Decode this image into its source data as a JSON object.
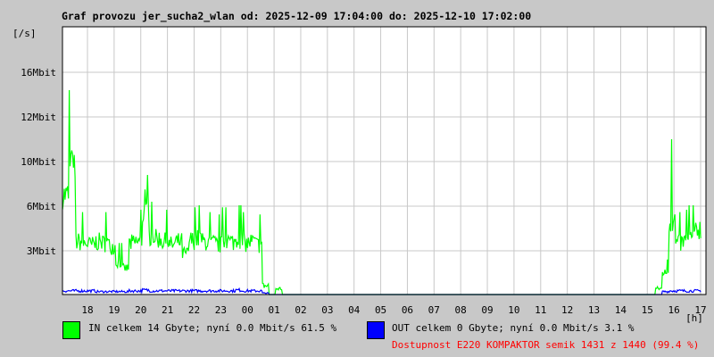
{
  "chart_data": {
    "type": "line",
    "title": "Graf provozu jer_sucha2_wlan od: 2025-12-09 17:04:00 do: 2025-12-10 17:02:00",
    "ylabel": "[/s]",
    "xlabel": "[h]",
    "y_ticks": [
      {
        "label": "3Mbit",
        "value": 3
      },
      {
        "label": "6Mbit",
        "value": 6
      },
      {
        "label": "10Mbit",
        "value": 10
      },
      {
        "label": "12Mbit",
        "value": 12
      },
      {
        "label": "16Mbit",
        "value": 16
      }
    ],
    "x_ticks": [
      "18",
      "19",
      "20",
      "21",
      "22",
      "23",
      "00",
      "01",
      "02",
      "03",
      "04",
      "05",
      "06",
      "07",
      "08",
      "09",
      "10",
      "11",
      "12",
      "13",
      "14",
      "15",
      "16",
      "17"
    ],
    "start_time": "17:04",
    "interval_minutes": 15,
    "grid": true,
    "series": [
      {
        "name": "IN",
        "color": "#00ff00",
        "unit": "Mbit/s",
        "values": [
          7,
          9,
          3.6,
          3.5,
          3.4,
          3.6,
          3.5,
          3.3,
          2.2,
          1.8,
          3.5,
          3.6,
          5.5,
          4.0,
          3.8,
          3.6,
          3.4,
          3.6,
          2.8,
          3.7,
          3.8,
          3.6,
          3.5,
          3.4,
          3.7,
          3.6,
          3.8,
          3.5,
          3.6,
          3.4,
          0.6,
          0,
          0.4,
          0,
          0,
          0,
          0,
          0,
          0,
          0,
          0,
          0,
          0,
          0,
          0,
          0,
          0,
          0,
          0,
          0,
          0,
          0,
          0,
          0,
          0,
          0,
          0,
          0,
          0,
          0,
          0,
          0,
          0,
          0,
          0,
          0,
          0,
          0,
          0,
          0,
          0,
          0,
          0,
          0,
          0,
          0,
          0,
          0,
          0,
          0,
          0,
          0,
          0,
          0,
          0,
          0,
          0,
          0,
          0,
          0.4,
          1.5,
          5,
          3.5,
          3.6,
          3.8,
          4.5
        ],
        "peaks": [
          {
            "index": 1,
            "value": 10.5
          },
          {
            "index": 12,
            "value": 7.5
          },
          {
            "index": 91,
            "value": 11
          }
        ]
      },
      {
        "name": "OUT",
        "color": "#0000ff",
        "unit": "Mbit/s",
        "values": [
          0.25,
          0.25,
          0.25,
          0.25,
          0.25,
          0.2,
          0.2,
          0.2,
          0.2,
          0.2,
          0.25,
          0.25,
          0.3,
          0.25,
          0.25,
          0.25,
          0.25,
          0.25,
          0.25,
          0.25,
          0.25,
          0.25,
          0.25,
          0.25,
          0.25,
          0.25,
          0.3,
          0.25,
          0.25,
          0.25,
          0.1,
          0,
          0,
          0,
          0,
          0,
          0,
          0,
          0,
          0,
          0,
          0,
          0,
          0,
          0,
          0,
          0,
          0,
          0,
          0,
          0,
          0,
          0,
          0,
          0,
          0,
          0,
          0,
          0,
          0,
          0,
          0,
          0,
          0,
          0,
          0,
          0,
          0,
          0,
          0,
          0,
          0,
          0,
          0,
          0,
          0,
          0,
          0,
          0,
          0,
          0,
          0,
          0,
          0,
          0,
          0,
          0,
          0,
          0,
          0,
          0.2,
          0.25,
          0.25,
          0.25,
          0.25,
          0.25
        ]
      }
    ]
  },
  "legend": {
    "in_text": "IN celkem 14 Gbyte; nyní   0.0 Mbit/s 61.5 %",
    "out_text": "OUT celkem 0 Gbyte; nyní   0.0 Mbit/s 3.1 %",
    "availability": "Dostupnost E220 KOMPAKTOR semik 1431 z 1440 (99.4 %)",
    "in_color": "#00ff00",
    "out_color": "#0000ff",
    "availability_color": "#ff0000"
  }
}
